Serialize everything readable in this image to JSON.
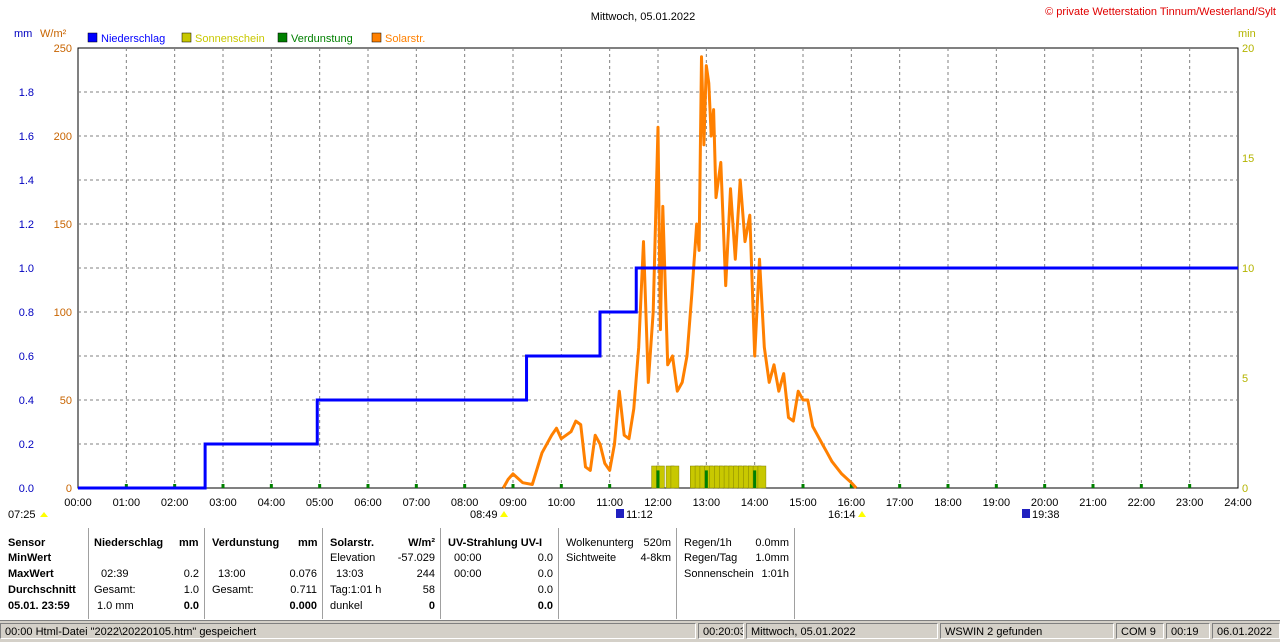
{
  "header": {
    "title": "Mittwoch, 05.01.2022",
    "copyright": "© private Wetterstation Tinnum/Westerland/Sylt",
    "unit_mm": "mm",
    "unit_wm2": "W/m²",
    "unit_min": "min"
  },
  "legend": [
    {
      "label": "Niederschlag",
      "color": "#0000ff"
    },
    {
      "label": "Sonnenschein",
      "color": "#c8c800"
    },
    {
      "label": "Verdunstung",
      "color": "#008000"
    },
    {
      "label": "Solarstr.",
      "color": "#ff8000"
    }
  ],
  "colors": {
    "precip": "#0000ff",
    "solar": "#ff8000",
    "sun": "#c8c800",
    "evap": "#008000",
    "grid": "#808080",
    "left_axis_mm": "#0000c0",
    "left_axis_wm2": "#c86400",
    "right_axis": "#b4b400"
  },
  "chart_data": {
    "type": "line",
    "x_ticks": [
      "00:00",
      "01:00",
      "02:00",
      "03:00",
      "04:00",
      "05:00",
      "06:00",
      "07:00",
      "08:00",
      "09:00",
      "10:00",
      "11:00",
      "12:00",
      "13:00",
      "14:00",
      "15:00",
      "16:00",
      "17:00",
      "18:00",
      "19:00",
      "20:00",
      "21:00",
      "22:00",
      "23:00",
      "24:00"
    ],
    "x_range_hours": [
      0,
      24
    ],
    "y_left_mm": {
      "ticks": [
        "0.0",
        "0.2",
        "0.4",
        "0.6",
        "0.8",
        "1.0",
        "1.2",
        "1.4",
        "1.6",
        "1.8"
      ],
      "range": [
        0,
        2.0
      ]
    },
    "y_left_wm2": {
      "ticks": [
        "0",
        "50",
        "100",
        "150",
        "200",
        "250"
      ],
      "range": [
        0,
        250
      ]
    },
    "y_right_min": {
      "ticks": [
        "0",
        "5",
        "10",
        "15",
        "20"
      ],
      "range": [
        0,
        20
      ]
    },
    "grid": true,
    "series": [
      {
        "name": "Niederschlag",
        "axis": "mm",
        "type": "step",
        "x_hours": [
          0,
          2.63,
          4.95,
          9.28,
          10.8,
          11.55,
          24
        ],
        "values": [
          0,
          0.2,
          0.4,
          0.6,
          0.8,
          1.0,
          1.0
        ]
      },
      {
        "name": "Solarstr.",
        "axis": "wm2",
        "type": "line",
        "x_hours": [
          8.8,
          8.9,
          9.0,
          9.2,
          9.4,
          9.6,
          9.8,
          9.9,
          10.0,
          10.2,
          10.3,
          10.4,
          10.5,
          10.6,
          10.7,
          10.8,
          10.9,
          11.0,
          11.1,
          11.2,
          11.3,
          11.4,
          11.5,
          11.6,
          11.7,
          11.8,
          11.9,
          12.0,
          12.05,
          12.1,
          12.2,
          12.3,
          12.4,
          12.5,
          12.6,
          12.7,
          12.8,
          12.85,
          12.9,
          12.95,
          13.0,
          13.05,
          13.1,
          13.15,
          13.2,
          13.3,
          13.4,
          13.5,
          13.6,
          13.7,
          13.8,
          13.9,
          14.0,
          14.1,
          14.2,
          14.3,
          14.4,
          14.5,
          14.6,
          14.7,
          14.8,
          14.9,
          15.0,
          15.1,
          15.2,
          15.3,
          15.4,
          15.5,
          15.6,
          15.8,
          16.0,
          16.1
        ],
        "values": [
          0,
          5,
          8,
          3,
          2,
          20,
          30,
          34,
          28,
          32,
          38,
          36,
          12,
          10,
          30,
          25,
          14,
          10,
          25,
          55,
          30,
          28,
          45,
          80,
          140,
          60,
          100,
          205,
          90,
          160,
          70,
          75,
          55,
          60,
          75,
          110,
          150,
          135,
          245,
          195,
          240,
          230,
          200,
          215,
          165,
          185,
          115,
          170,
          130,
          175,
          140,
          155,
          75,
          130,
          80,
          60,
          70,
          55,
          65,
          40,
          38,
          55,
          50,
          50,
          35,
          30,
          25,
          20,
          15,
          8,
          3,
          0
        ]
      },
      {
        "name": "Sonnenschein",
        "axis": "min",
        "type": "bar",
        "x_hours": [
          11.95,
          12.05,
          12.25,
          12.35,
          12.75,
          12.85,
          12.95,
          13.05,
          13.15,
          13.25,
          13.35,
          13.45,
          13.55,
          13.65,
          13.75,
          13.85,
          13.95,
          14.05,
          14.15
        ],
        "values": [
          1,
          1,
          1,
          1,
          1,
          1,
          1,
          1,
          1,
          1,
          1,
          1,
          1,
          1,
          1,
          1,
          1,
          1,
          1
        ]
      },
      {
        "name": "Verdunstung",
        "axis": "mm",
        "type": "bar",
        "x_hours": [
          1,
          2,
          3,
          4,
          5,
          6,
          7,
          8,
          9,
          10,
          11,
          12,
          13,
          14,
          15,
          16,
          17,
          18,
          19,
          20,
          21,
          22,
          23
        ],
        "values": [
          0.01,
          0.01,
          0.01,
          0.01,
          0.01,
          0.01,
          0.01,
          0.01,
          0.01,
          0.01,
          0.01,
          0.08,
          0.08,
          0.08,
          0.01,
          0.01,
          0.01,
          0.01,
          0.01,
          0.01,
          0.01,
          0.01,
          0.01
        ]
      }
    ]
  },
  "astro": {
    "dawn": "07:25",
    "sunrise": "08:49",
    "moonrise": "11:12",
    "sunset": "16:14",
    "moonset": "19:38"
  },
  "table": {
    "sensor": {
      "title": "Sensor",
      "min": "MinWert",
      "max": "MaxWert",
      "avg": "Durchschnitt",
      "date": "05.01. 23:59"
    },
    "precip": {
      "title": "Niederschlag",
      "unit": "mm",
      "max_time": "02:39",
      "max_val": "0.2",
      "total_label": "Gesamt:",
      "total_val": "1.0",
      "avg_label": "1.0 mm",
      "avg_val": "0.0"
    },
    "evap": {
      "title": "Verdunstung",
      "unit": "mm",
      "max_time": "13:00",
      "max_val": "0.076",
      "total_label": "Gesamt:",
      "total_val": "0.711",
      "avg_val": "0.000"
    },
    "solar": {
      "title": "Solarstr.",
      "unit": "W/m²",
      "elev_label": "Elevation",
      "elev_val": "-57.029",
      "max_time": "13:03",
      "max_val": "244",
      "day_label": "Tag:1:01 h",
      "day_val": "58",
      "dark_label": "dunkel",
      "dark_val": "0"
    },
    "uv": {
      "title": "UV-Strahlung UV-I",
      "min_time": "00:00",
      "min_val": "0.0",
      "max_time": "00:00",
      "max_val": "0.0",
      "v3": "0.0",
      "v4": "0.0"
    },
    "cloud": {
      "base_label": "Wolkenunterg",
      "base_val": "520m",
      "vis_label": "Sichtweite",
      "vis_val": "4-8km"
    },
    "rain": {
      "r1_label": "Regen/1h",
      "r1_val": "0.0mm",
      "rd_label": "Regen/Tag",
      "rd_val": "1.0mm",
      "sun_label": "Sonnenschein",
      "sun_val": "1:01h"
    }
  },
  "status": {
    "left": "00:00  Html-Datei  \"2022\\20220105.htm\"  gespeichert",
    "time": "00:20:03",
    "date": "Mittwoch, 05.01.2022",
    "wswin": "WSWIN 2 gefunden",
    "com": "COM 9",
    "clock": "00:19",
    "today": "06.01.2022"
  }
}
